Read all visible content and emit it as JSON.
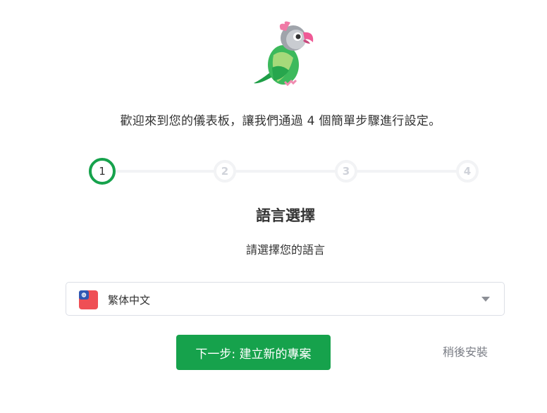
{
  "logo": {
    "icon": "parrot-mascot-icon"
  },
  "welcome_text": "歡迎來到您的儀表板，讓我們通過 4 個簡單步驟進行設定。",
  "steps": [
    {
      "label": "1",
      "state": "active"
    },
    {
      "label": "2",
      "state": "inactive"
    },
    {
      "label": "3",
      "state": "inactive"
    },
    {
      "label": "4",
      "state": "inactive"
    }
  ],
  "section": {
    "title": "語言選擇",
    "subtitle": "請選擇您的語言"
  },
  "language_select": {
    "value": "繁体中文",
    "flag_icon": "taiwan-flag-icon"
  },
  "actions": {
    "next_label": "下一步: 建立新的專案",
    "later_label": "稍後安裝"
  },
  "colors": {
    "accent": "#16a24c",
    "step_inactive": "#f2f3f5",
    "muted_text": "#7a7d85"
  }
}
